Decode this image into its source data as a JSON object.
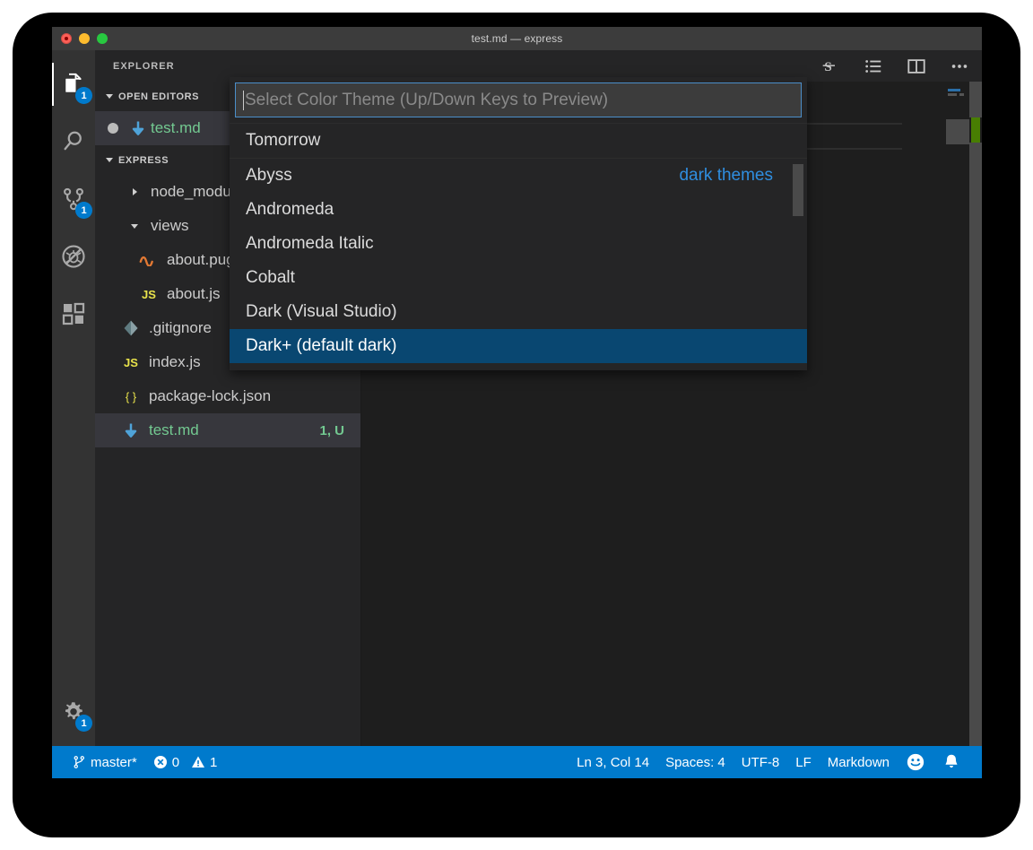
{
  "window": {
    "title": "test.md — express",
    "traffic": {
      "close": "close-button",
      "minimize": "minimize-button",
      "zoom": "zoom-button"
    }
  },
  "activitybar": {
    "items": [
      {
        "name": "explorer",
        "icon": "files-icon",
        "badge": "1",
        "active": true
      },
      {
        "name": "search",
        "icon": "search-icon",
        "badge": "",
        "active": false
      },
      {
        "name": "source-control",
        "icon": "source-control-icon",
        "badge": "1",
        "active": false
      },
      {
        "name": "run-and-debug",
        "icon": "debug-disabled-icon",
        "badge": "",
        "active": false
      },
      {
        "name": "extensions",
        "icon": "extensions-icon",
        "badge": "",
        "active": false
      }
    ],
    "bottom": {
      "name": "manage",
      "icon": "gear-icon",
      "badge": "1"
    }
  },
  "sidebar": {
    "title": "EXPLORER",
    "sections": [
      {
        "label": "OPEN EDITORS",
        "expanded": true
      },
      {
        "label": "EXPRESS",
        "expanded": true
      }
    ],
    "open_editors": [
      {
        "label": "test.md",
        "icon": "markdown-icon",
        "dirty": true,
        "selected": true
      }
    ],
    "tree": [
      {
        "label": "node_modules",
        "type": "folder",
        "expanded": false,
        "indent": 1,
        "icon": "chevron-right-icon",
        "status": ""
      },
      {
        "label": "views",
        "type": "folder",
        "expanded": true,
        "indent": 1,
        "icon": "chevron-down-icon",
        "status": ""
      },
      {
        "label": "about.pug",
        "type": "file",
        "indent": 2,
        "icon": "pug-icon",
        "status": ""
      },
      {
        "label": "about.js",
        "type": "file",
        "indent": 2,
        "icon": "js-icon",
        "status": ""
      },
      {
        "label": ".gitignore",
        "type": "file",
        "indent": 1,
        "icon": "gitignore-icon",
        "status": ""
      },
      {
        "label": "index.js",
        "type": "file",
        "indent": 1,
        "icon": "js-icon",
        "status": ""
      },
      {
        "label": "package-lock.json",
        "type": "file",
        "indent": 1,
        "icon": "json-icon",
        "status": ""
      },
      {
        "label": "test.md",
        "type": "file",
        "indent": 1,
        "icon": "markdown-icon",
        "status": "1, U",
        "selected": true,
        "modified": true
      }
    ]
  },
  "editor_toolbar": {
    "actions": [
      {
        "name": "markdown-preview",
        "icon": "strikethrough-s-icon"
      },
      {
        "name": "outline-list",
        "icon": "list-icon"
      },
      {
        "name": "split-editor",
        "icon": "split-editor-icon"
      },
      {
        "name": "more-actions",
        "icon": "ellipsis-icon"
      }
    ]
  },
  "quickpick": {
    "placeholder": "Select Color Theme (Up/Down Keys to Preview)",
    "value": "",
    "items": [
      {
        "label": "Tomorrow",
        "description": "",
        "focused": false
      },
      {
        "label": "Abyss",
        "description": "dark themes",
        "focused": false
      },
      {
        "label": "Andromeda",
        "description": "",
        "focused": false
      },
      {
        "label": "Andromeda Italic",
        "description": "",
        "focused": false
      },
      {
        "label": "Cobalt",
        "description": "",
        "focused": false
      },
      {
        "label": "Dark (Visual Studio)",
        "description": "",
        "focused": false
      },
      {
        "label": "Dark+ (default dark)",
        "description": "",
        "focused": true
      }
    ]
  },
  "statusbar": {
    "branch": "master*",
    "errors": "0",
    "warnings": "1",
    "cursor": "Ln 3, Col 14",
    "indent": "Spaces: 4",
    "encoding": "UTF-8",
    "eol": "LF",
    "language": "Markdown",
    "feedback_icon": "smiley-icon",
    "notifications_icon": "bell-icon"
  },
  "colors": {
    "accent": "#007acc",
    "focus_row": "#094771",
    "description_blue": "#2f8ee0",
    "git_green": "#73c991",
    "editor_bg": "#1e1e1e",
    "sidebar_bg": "#252526",
    "activitybar_bg": "#333333",
    "titlebar_bg": "#3c3c3c"
  }
}
